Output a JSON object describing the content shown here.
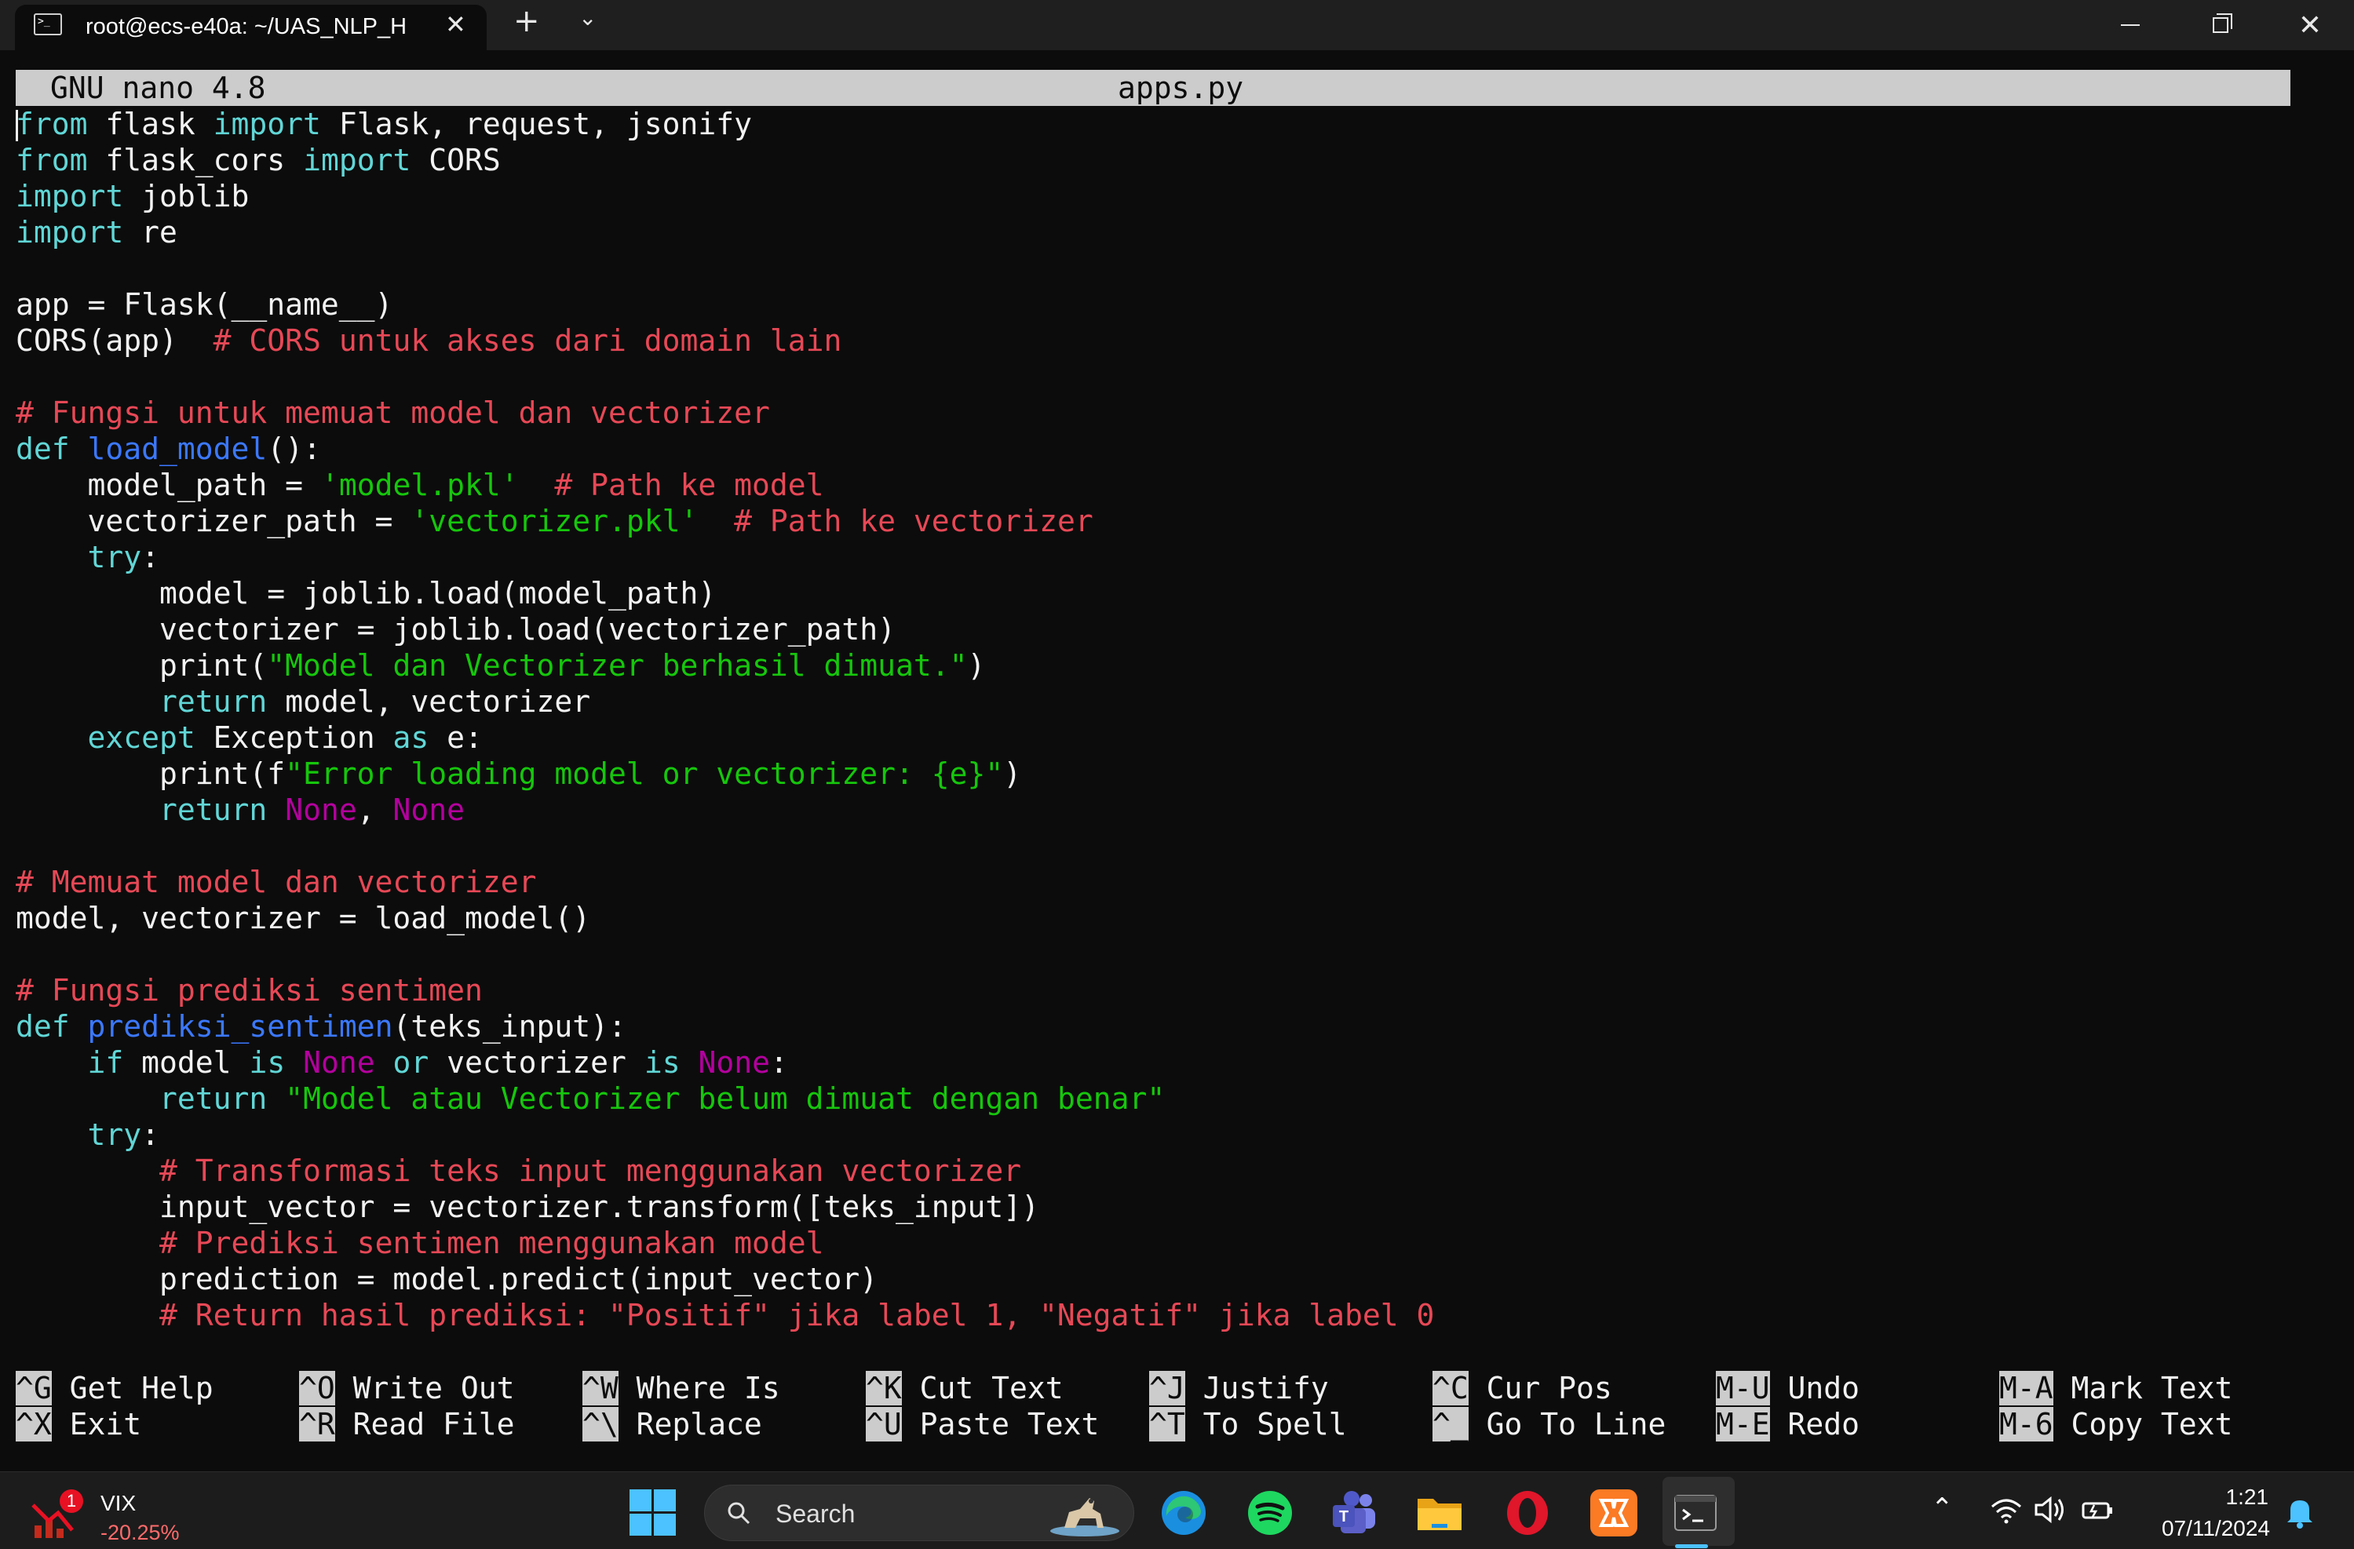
{
  "window": {
    "tab_title": "root@ecs-e40a: ~/UAS_NLP_H",
    "tab_icon": "terminal-icon",
    "new_tab": "+",
    "close_tab": "✕",
    "close_window": "✕"
  },
  "nano": {
    "version": "GNU nano 4.8",
    "filename": "apps.py"
  },
  "code": [
    [
      [
        "kw",
        "from"
      ],
      [
        "txt",
        " flask "
      ],
      [
        "kw",
        "import"
      ],
      [
        "txt",
        " Flask, request, jsonify"
      ]
    ],
    [
      [
        "kw",
        "from"
      ],
      [
        "txt",
        " flask_cors "
      ],
      [
        "kw",
        "import"
      ],
      [
        "txt",
        " CORS"
      ]
    ],
    [
      [
        "kw",
        "import"
      ],
      [
        "txt",
        " joblib"
      ]
    ],
    [
      [
        "kw",
        "import"
      ],
      [
        "txt",
        " re"
      ]
    ],
    [],
    [
      [
        "txt",
        "app = Flask(__name__)"
      ]
    ],
    [
      [
        "txt",
        "CORS(app)  "
      ],
      [
        "cm",
        "# CORS untuk akses dari domain lain"
      ]
    ],
    [],
    [
      [
        "cm",
        "# Fungsi untuk memuat model dan vectorizer"
      ]
    ],
    [
      [
        "kw",
        "def"
      ],
      [
        "txt",
        " "
      ],
      [
        "fn",
        "load_model"
      ],
      [
        "txt",
        "():"
      ]
    ],
    [
      [
        "txt",
        "    model_path = "
      ],
      [
        "str",
        "'model.pkl'"
      ],
      [
        "txt",
        "  "
      ],
      [
        "cm",
        "# Path ke model"
      ]
    ],
    [
      [
        "txt",
        "    vectorizer_path = "
      ],
      [
        "str",
        "'vectorizer.pkl'"
      ],
      [
        "txt",
        "  "
      ],
      [
        "cm",
        "# Path ke vectorizer"
      ]
    ],
    [
      [
        "txt",
        "    "
      ],
      [
        "kw",
        "try"
      ],
      [
        "txt",
        ":"
      ]
    ],
    [
      [
        "txt",
        "        model = joblib.load(model_path)"
      ]
    ],
    [
      [
        "txt",
        "        vectorizer = joblib.load(vectorizer_path)"
      ]
    ],
    [
      [
        "txt",
        "        print("
      ],
      [
        "str",
        "\"Model dan Vectorizer berhasil dimuat.\""
      ],
      [
        "txt",
        ")"
      ]
    ],
    [
      [
        "txt",
        "        "
      ],
      [
        "kw",
        "return"
      ],
      [
        "txt",
        " model, vectorizer"
      ]
    ],
    [
      [
        "txt",
        "    "
      ],
      [
        "kw",
        "except"
      ],
      [
        "txt",
        " Exception "
      ],
      [
        "kw",
        "as"
      ],
      [
        "txt",
        " e:"
      ]
    ],
    [
      [
        "txt",
        "        print(f"
      ],
      [
        "str",
        "\"Error loading model or vectorizer: {e}\""
      ],
      [
        "txt",
        ")"
      ]
    ],
    [
      [
        "txt",
        "        "
      ],
      [
        "kw",
        "return"
      ],
      [
        "txt",
        " "
      ],
      [
        "cst",
        "None"
      ],
      [
        "txt",
        ", "
      ],
      [
        "cst",
        "None"
      ]
    ],
    [],
    [
      [
        "cm",
        "# Memuat model dan vectorizer"
      ]
    ],
    [
      [
        "txt",
        "model, vectorizer = load_model()"
      ]
    ],
    [],
    [
      [
        "cm",
        "# Fungsi prediksi sentimen"
      ]
    ],
    [
      [
        "kw",
        "def"
      ],
      [
        "txt",
        " "
      ],
      [
        "fn",
        "prediksi_sentimen"
      ],
      [
        "txt",
        "(teks_input):"
      ]
    ],
    [
      [
        "txt",
        "    "
      ],
      [
        "kw",
        "if"
      ],
      [
        "txt",
        " model "
      ],
      [
        "kw",
        "is"
      ],
      [
        "txt",
        " "
      ],
      [
        "cst",
        "None"
      ],
      [
        "txt",
        " "
      ],
      [
        "kw",
        "or"
      ],
      [
        "txt",
        " vectorizer "
      ],
      [
        "kw",
        "is"
      ],
      [
        "txt",
        " "
      ],
      [
        "cst",
        "None"
      ],
      [
        "txt",
        ":"
      ]
    ],
    [
      [
        "txt",
        "        "
      ],
      [
        "kw",
        "return"
      ],
      [
        "txt",
        " "
      ],
      [
        "str",
        "\"Model atau Vectorizer belum dimuat dengan benar\""
      ]
    ],
    [
      [
        "txt",
        "    "
      ],
      [
        "kw",
        "try"
      ],
      [
        "txt",
        ":"
      ]
    ],
    [
      [
        "txt",
        "        "
      ],
      [
        "cm",
        "# Transformasi teks input menggunakan vectorizer"
      ]
    ],
    [
      [
        "txt",
        "        input_vector = vectorizer.transform([teks_input])"
      ]
    ],
    [
      [
        "txt",
        "        "
      ],
      [
        "cm",
        "# Prediksi sentimen menggunakan model"
      ]
    ],
    [
      [
        "txt",
        "        prediction = model.predict(input_vector)"
      ]
    ],
    [
      [
        "txt",
        "        "
      ],
      [
        "cm",
        "# Return hasil prediksi: \"Positif\" jika label 1, \"Negatif\" jika label 0"
      ]
    ]
  ],
  "shortcuts": [
    {
      "key1": "^G",
      "label1": "Get Help",
      "key2": "^X",
      "label2": "Exit"
    },
    {
      "key1": "^O",
      "label1": "Write Out",
      "key2": "^R",
      "label2": "Read File"
    },
    {
      "key1": "^W",
      "label1": "Where Is",
      "key2": "^\\",
      "label2": "Replace"
    },
    {
      "key1": "^K",
      "label1": "Cut Text",
      "key2": "^U",
      "label2": "Paste Text"
    },
    {
      "key1": "^J",
      "label1": "Justify",
      "key2": "^T",
      "label2": "To Spell"
    },
    {
      "key1": "^C",
      "label1": "Cur Pos",
      "key2": "^_",
      "label2": "Go To Line"
    },
    {
      "key1": "M-U",
      "label1": "Undo",
      "key2": "M-E",
      "label2": "Redo"
    },
    {
      "key1": "M-A",
      "label1": "Mark Text",
      "key2": "M-6",
      "label2": "Copy Text"
    }
  ],
  "taskbar": {
    "widget": {
      "badge": "1",
      "title": "VIX",
      "value": "-20.25%"
    },
    "search_placeholder": "Search",
    "apps": [
      "edge-icon",
      "spotify-icon",
      "teams-icon",
      "file-explorer-icon",
      "opera-icon",
      "xampp-icon",
      "terminal-icon"
    ],
    "clock_time": "1:21",
    "clock_date": "07/11/2024"
  },
  "colors": {
    "background": "#0c0c0c",
    "keyword": "#61d6d6",
    "function": "#3b78ff",
    "comment": "#e74856",
    "string": "#16c60c",
    "constant": "#b4009e",
    "accent": "#4cc2ff"
  }
}
